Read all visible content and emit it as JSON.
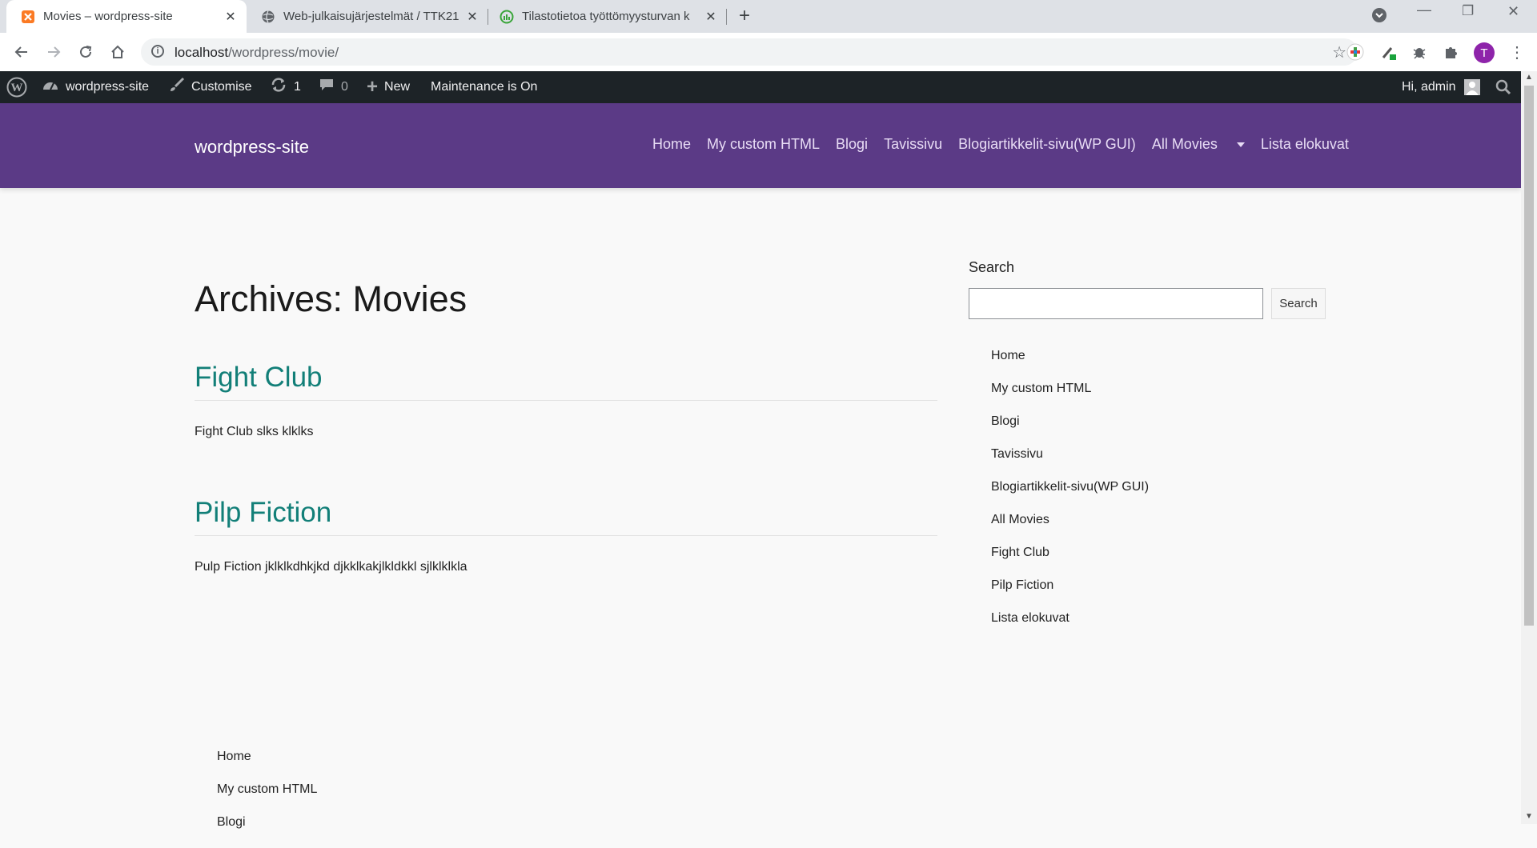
{
  "browser": {
    "tabs": [
      {
        "title": "Movies – wordpress-site",
        "active": true
      },
      {
        "title": "Web-julkaisujärjestelmät / TTK21",
        "active": false
      },
      {
        "title": "Tilastotietoa työttömyysturvan k",
        "active": false
      }
    ],
    "address": {
      "host": "localhost",
      "path": "/wordpress/movie/"
    },
    "profile_initial": "T"
  },
  "adminbar": {
    "site_name": "wordpress-site",
    "customise": "Customise",
    "updates_count": "1",
    "comments_count": "0",
    "new_label": "New",
    "maintenance": "Maintenance is On",
    "greeting": "Hi, admin"
  },
  "site": {
    "title": "wordpress-site",
    "menu": [
      "Home",
      "My custom HTML",
      "Blogi",
      "Tavissivu",
      "Blogiartikkelit-sivu(WP GUI)",
      "All Movies",
      "Lista elokuvat"
    ]
  },
  "archive": {
    "title": "Archives: Movies",
    "posts": [
      {
        "title": "Fight Club",
        "excerpt": "Fight Club slks klklks"
      },
      {
        "title": "Pilp Fiction",
        "excerpt": "Pulp Fiction jklklkdhkjkd djkklkakjlkldkkl sjlklklkla"
      }
    ]
  },
  "sidebar": {
    "search_label": "Search",
    "search_button": "Search",
    "search_value": "",
    "pages": [
      "Home",
      "My custom HTML",
      "Blogi",
      "Tavissivu",
      "Blogiartikkelit-sivu(WP GUI)",
      "All Movies",
      "Fight Club",
      "Pilp Fiction",
      "Lista elokuvat"
    ]
  },
  "footer": {
    "pages": [
      "Home",
      "My custom HTML",
      "Blogi"
    ]
  },
  "colors": {
    "header_bg": "#5b3a86",
    "adminbar_bg": "#1d2327",
    "link_teal": "#127f78"
  }
}
